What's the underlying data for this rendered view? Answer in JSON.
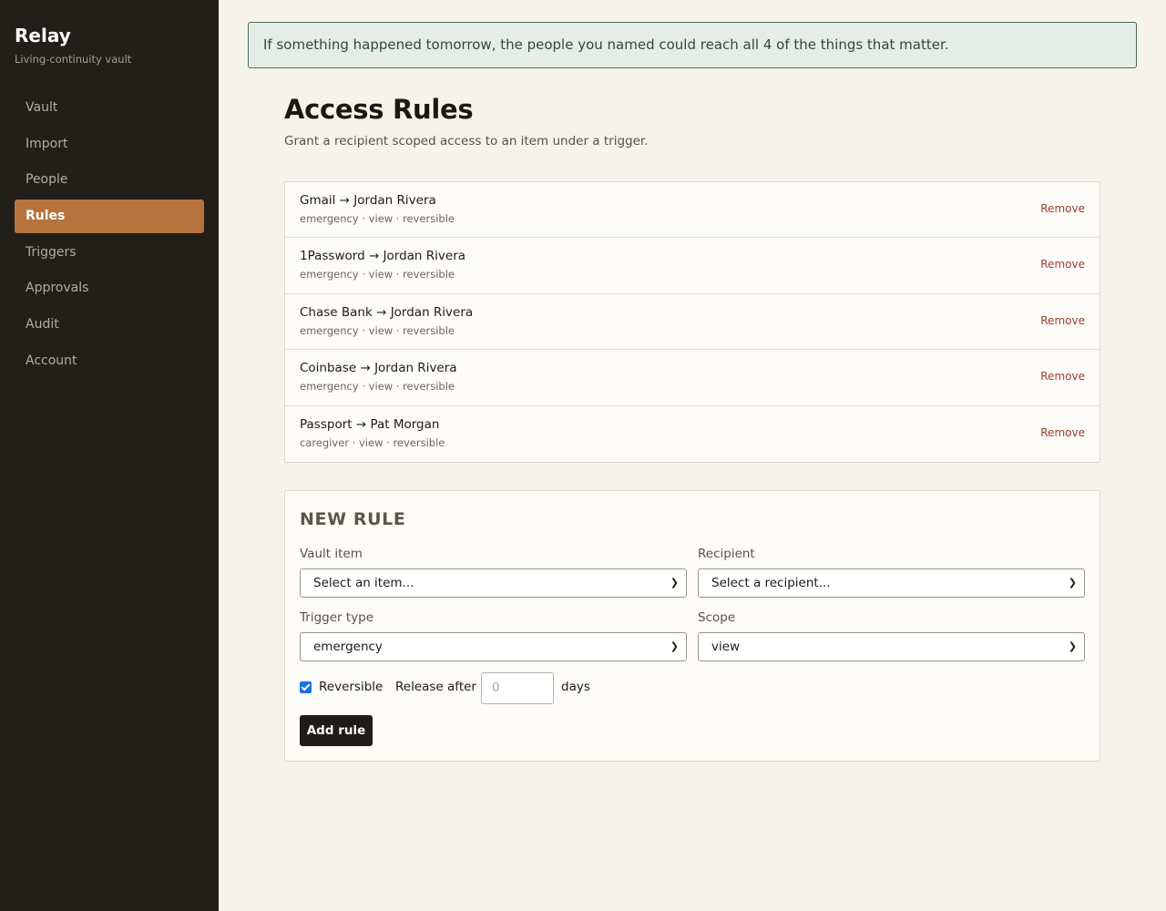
{
  "app": {
    "name": "Relay",
    "tagline": "Living-continuity vault"
  },
  "sidebar": {
    "items": [
      {
        "label": "Vault",
        "active": false
      },
      {
        "label": "Import",
        "active": false
      },
      {
        "label": "People",
        "active": false
      },
      {
        "label": "Rules",
        "active": true
      },
      {
        "label": "Triggers",
        "active": false
      },
      {
        "label": "Approvals",
        "active": false
      },
      {
        "label": "Audit",
        "active": false
      },
      {
        "label": "Account",
        "active": false
      }
    ]
  },
  "banner": {
    "text": "If something happened tomorrow, the people you named could reach all 4 of the things that matter."
  },
  "page": {
    "title": "Access Rules",
    "subtitle": "Grant a recipient scoped access to an item under a trigger."
  },
  "rules": [
    {
      "title": "Gmail → Jordan Rivera",
      "meta": "emergency · view · reversible",
      "remove_label": "Remove"
    },
    {
      "title": "1Password → Jordan Rivera",
      "meta": "emergency · view · reversible",
      "remove_label": "Remove"
    },
    {
      "title": "Chase Bank → Jordan Rivera",
      "meta": "emergency · view · reversible",
      "remove_label": "Remove"
    },
    {
      "title": "Coinbase → Jordan Rivera",
      "meta": "emergency · view · reversible",
      "remove_label": "Remove"
    },
    {
      "title": "Passport → Pat Morgan",
      "meta": "caregiver · view · reversible",
      "remove_label": "Remove"
    }
  ],
  "new_rule": {
    "heading": "NEW RULE",
    "vault_item": {
      "label": "Vault item",
      "value": "Select an item..."
    },
    "recipient": {
      "label": "Recipient",
      "value": "Select a recipient..."
    },
    "trigger_type": {
      "label": "Trigger type",
      "value": "emergency"
    },
    "scope": {
      "label": "Scope",
      "value": "view"
    },
    "reversible": {
      "label": "Reversible",
      "checked": true
    },
    "release_after": {
      "label": "Release after",
      "placeholder": "0",
      "unit": "days"
    },
    "submit_label": "Add rule"
  },
  "colors": {
    "sidebar_bg": "#221e1a",
    "accent": "#b7733e",
    "banner_bg": "#e6ede8",
    "banner_border": "#4c6a5a",
    "remove": "#a13c30",
    "checkbox": "#1a73e8"
  },
  "icons": {
    "select_chevron": "chevron-down-icon",
    "checkbox": "checkmark-icon"
  }
}
